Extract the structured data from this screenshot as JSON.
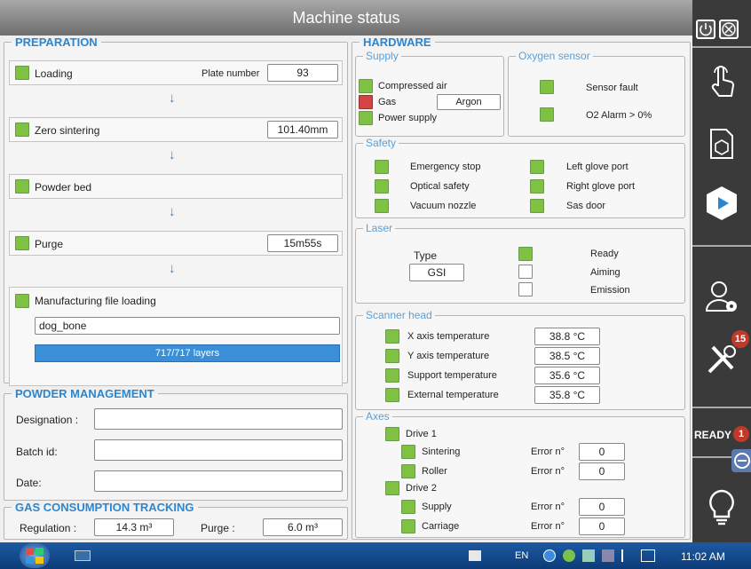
{
  "title": "Machine status",
  "preparation": {
    "legend": "PREPARATION",
    "loading": {
      "label": "Loading",
      "plate_label": "Plate number",
      "plate_value": "93"
    },
    "zero": {
      "label": "Zero sintering",
      "value": "101.40mm"
    },
    "powder_bed": {
      "label": "Powder bed"
    },
    "purge": {
      "label": "Purge",
      "value": "15m55s"
    },
    "manufacturing": {
      "label": "Manufacturing file loading",
      "file": "dog_bone",
      "progress_text": "717/717 layers",
      "progress": 1.0
    },
    "arrow": "↓"
  },
  "powder": {
    "legend": "POWDER MANAGEMENT",
    "designation_label": "Designation :",
    "designation_value": "",
    "batch_label": "Batch id:",
    "batch_value": "",
    "date_label": "Date:",
    "date_value": ""
  },
  "gas": {
    "legend": "GAS CONSUMPTION TRACKING",
    "regulation_label": "Regulation :",
    "regulation_value": "14.3 m³",
    "purge_label": "Purge :",
    "purge_value": "6.0 m³"
  },
  "hardware": {
    "legend": "HARDWARE",
    "supply": {
      "legend": "Supply",
      "compressed_air": "Compressed air",
      "gas": "Gas",
      "gas_value": "Argon",
      "power_supply": "Power supply"
    },
    "oxygen": {
      "legend": "Oxygen sensor",
      "sensor_fault": "Sensor fault",
      "o2_alarm": "O2 Alarm > 0%"
    },
    "safety": {
      "legend": "Safety",
      "emergency_stop": "Emergency stop",
      "optical_safety": "Optical safety",
      "vacuum_nozzle": "Vacuum nozzle",
      "left_glove": "Left glove port",
      "right_glove": "Right glove port",
      "sas_door": "Sas door"
    },
    "laser": {
      "legend": "Laser",
      "type_label": "Type",
      "type_value": "GSI",
      "ready": "Ready",
      "aiming": "Aiming",
      "emission": "Emission"
    },
    "scanner": {
      "legend": "Scanner head",
      "x_label": "X axis temperature",
      "x_value": "38.8 °C",
      "y_label": "Y axis temperature",
      "y_value": "38.5 °C",
      "support_label": "Support temperature",
      "support_value": "35.6 °C",
      "external_label": "External temperature",
      "external_value": "35.8 °C"
    },
    "axes": {
      "legend": "Axes",
      "error_label": "Error n°",
      "drive1": "Drive 1",
      "sintering": "Sintering",
      "sintering_err": "0",
      "roller": "Roller",
      "roller_err": "0",
      "drive2": "Drive 2",
      "supply": "Supply",
      "supply_err": "0",
      "carriage": "Carriage",
      "carriage_err": "0"
    }
  },
  "sidebar": {
    "tools_badge": "15",
    "ready_label": "READY",
    "ready_badge": "1"
  },
  "taskbar": {
    "lang": "EN",
    "time": "11:02 AM"
  },
  "colors": {
    "ok": "#7fc142",
    "alarm": "#d34545",
    "accent": "#2c86cf",
    "progress": "#3a8fd8"
  }
}
